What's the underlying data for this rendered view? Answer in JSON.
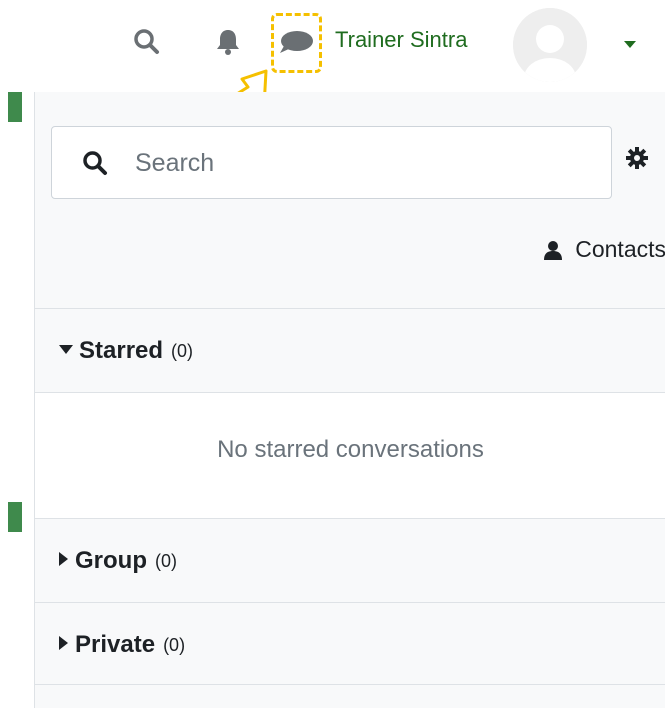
{
  "navbar": {
    "user_name": "Trainer Sintra",
    "icons": [
      "search-icon",
      "bell-icon",
      "message-icon",
      "chevron-down-icon"
    ]
  },
  "drawer": {
    "search_placeholder": "Search",
    "contacts_label": "Contacts",
    "sections": [
      {
        "title": "Starred",
        "count": "(0)",
        "expanded": true,
        "empty_text": "No starred conversations"
      },
      {
        "title": "Group",
        "count": "(0)",
        "expanded": false
      },
      {
        "title": "Private",
        "count": "(0)",
        "expanded": false
      }
    ]
  },
  "colors": {
    "user_name": "#1f6c1f",
    "highlight": "#f5c000",
    "accent_green": "#3f8a4c",
    "drawer_bg": "#f8f9fa"
  }
}
